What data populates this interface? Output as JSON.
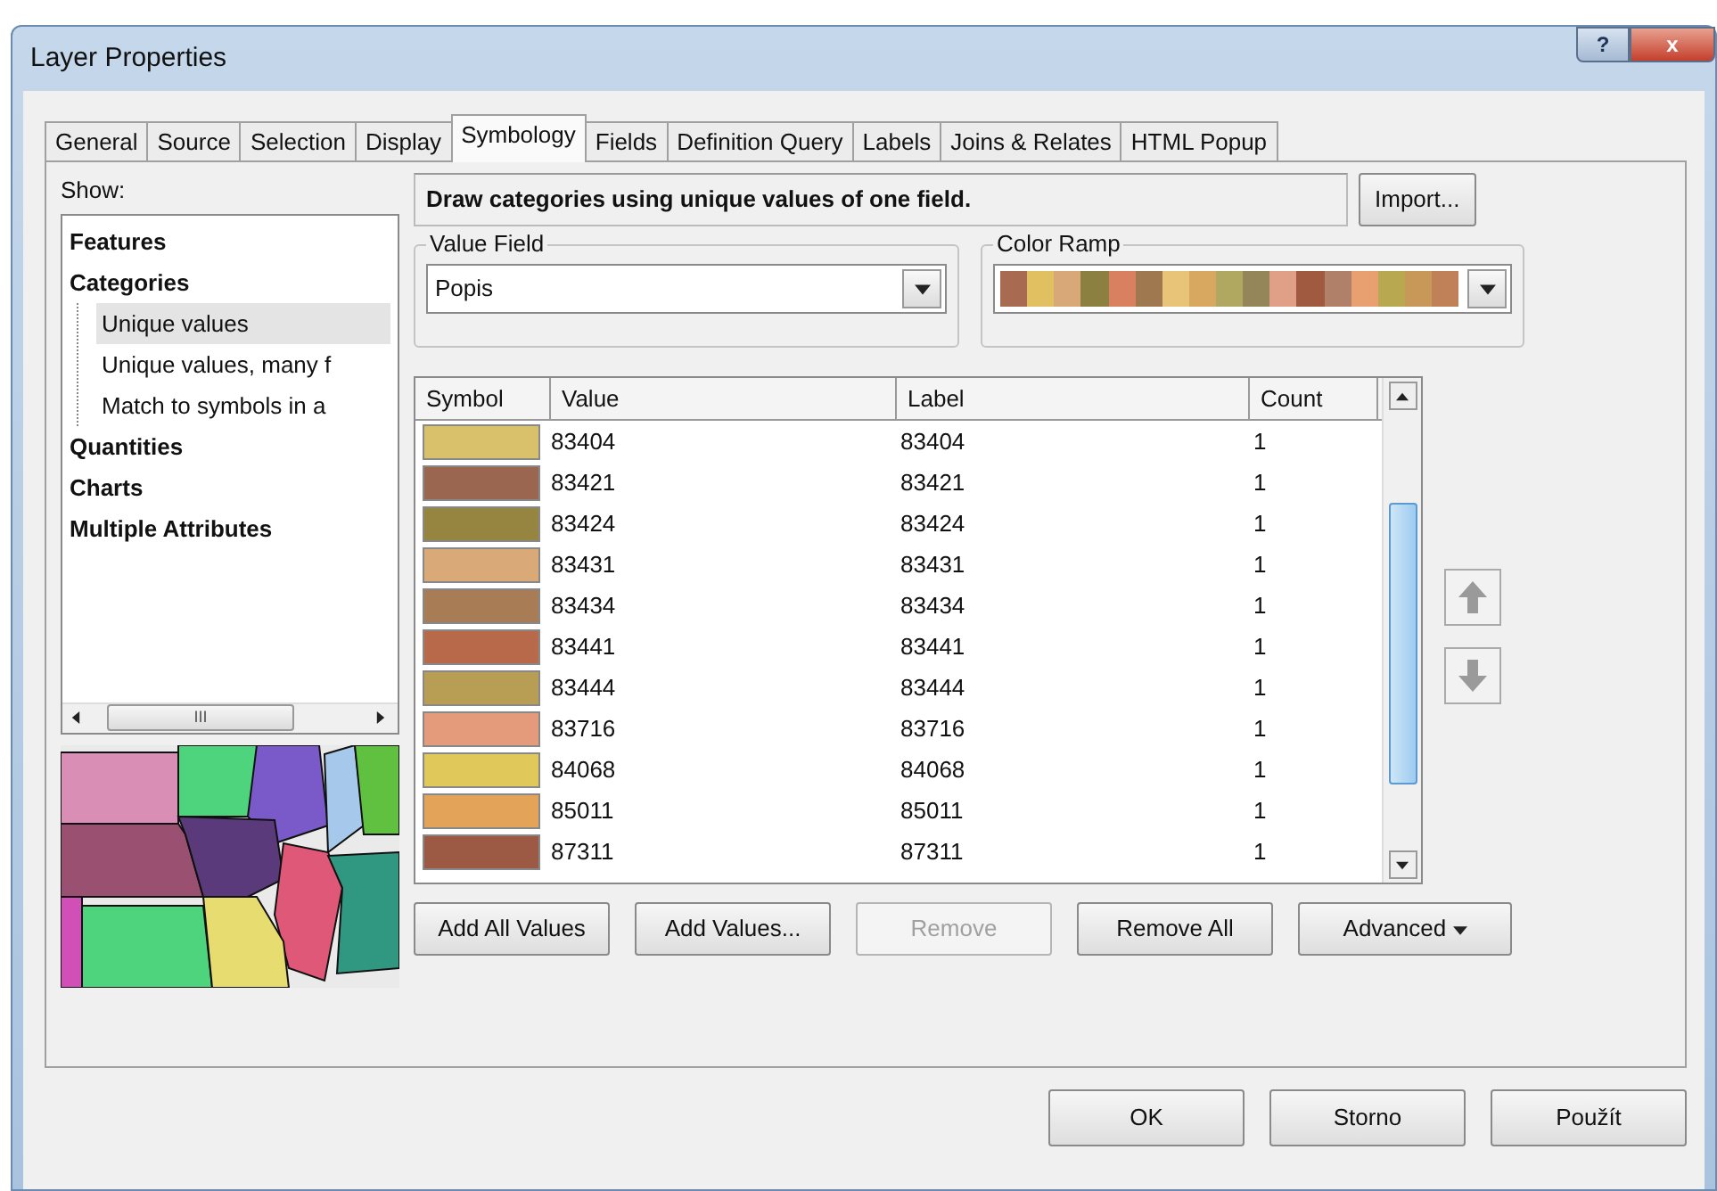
{
  "window": {
    "title": "Layer Properties",
    "help_button": "?",
    "close_button": "x"
  },
  "tabs": [
    {
      "label": "General",
      "selected": false
    },
    {
      "label": "Source",
      "selected": false
    },
    {
      "label": "Selection",
      "selected": false
    },
    {
      "label": "Display",
      "selected": false
    },
    {
      "label": "Symbology",
      "selected": true
    },
    {
      "label": "Fields",
      "selected": false
    },
    {
      "label": "Definition Query",
      "selected": false
    },
    {
      "label": "Labels",
      "selected": false
    },
    {
      "label": "Joins & Relates",
      "selected": false
    },
    {
      "label": "HTML Popup",
      "selected": false
    }
  ],
  "show": {
    "label": "Show:",
    "tree": [
      {
        "label": "Features",
        "selected": false
      },
      {
        "label": "Categories",
        "selected": false,
        "children": [
          {
            "label": "Unique values",
            "selected": true
          },
          {
            "label": "Unique values, many f",
            "selected": false
          },
          {
            "label": "Match to symbols in a",
            "selected": false
          }
        ]
      },
      {
        "label": "Quantities",
        "selected": false
      },
      {
        "label": "Charts",
        "selected": false
      },
      {
        "label": "Multiple Attributes",
        "selected": false
      }
    ],
    "scroll_thumb": "III"
  },
  "preview": {
    "kind": "picture"
  },
  "description": "Draw categories using unique values of one field.",
  "import_button": "Import...",
  "value_field": {
    "label": "Value Field",
    "value": "Popis"
  },
  "color_ramp": {
    "label": "Color Ramp",
    "swatches": [
      {
        "color": "#a86a50"
      },
      {
        "color": "#e0c060"
      },
      {
        "color": "#d9a878"
      },
      {
        "color": "#8c8040"
      },
      {
        "color": "#d98060"
      },
      {
        "color": "#a07850"
      },
      {
        "color": "#e8c478"
      },
      {
        "color": "#d8a860"
      },
      {
        "color": "#b0a860"
      },
      {
        "color": "#948658"
      },
      {
        "color": "#e0a088"
      },
      {
        "color": "#a05a40"
      },
      {
        "color": "#b08068"
      },
      {
        "color": "#e8a070"
      },
      {
        "color": "#b8a850"
      },
      {
        "color": "#c89858"
      },
      {
        "color": "#c08058"
      }
    ]
  },
  "table": {
    "columns": [
      "Symbol",
      "Value",
      "Label",
      "Count"
    ],
    "rows": [
      {
        "color": "#d9c06a",
        "value": "83404",
        "label": "83404",
        "count": "1"
      },
      {
        "color": "#9a6650",
        "value": "83421",
        "label": "83421",
        "count": "1"
      },
      {
        "color": "#958540",
        "value": "83424",
        "label": "83424",
        "count": "1"
      },
      {
        "color": "#d9aa78",
        "value": "83431",
        "label": "83431",
        "count": "1"
      },
      {
        "color": "#a87c55",
        "value": "83434",
        "label": "83434",
        "count": "1"
      },
      {
        "color": "#b8694a",
        "value": "83441",
        "label": "83441",
        "count": "1"
      },
      {
        "color": "#b89e55",
        "value": "83444",
        "label": "83444",
        "count": "1"
      },
      {
        "color": "#e39b7c",
        "value": "83716",
        "label": "83716",
        "count": "1"
      },
      {
        "color": "#e0c85a",
        "value": "84068",
        "label": "84068",
        "count": "1"
      },
      {
        "color": "#e3a45a",
        "value": "85011",
        "label": "85011",
        "count": "1"
      },
      {
        "color": "#9c5a45",
        "value": "87311",
        "label": "87311",
        "count": "1"
      }
    ]
  },
  "actions": [
    {
      "label": "Add All Values",
      "disabled": false
    },
    {
      "label": "Add Values...",
      "disabled": false
    },
    {
      "label": "Remove",
      "disabled": true
    },
    {
      "label": "Remove All",
      "disabled": false
    }
  ],
  "advanced_button": "Advanced",
  "buttons": [
    "OK",
    "Storno",
    "Použít"
  ]
}
